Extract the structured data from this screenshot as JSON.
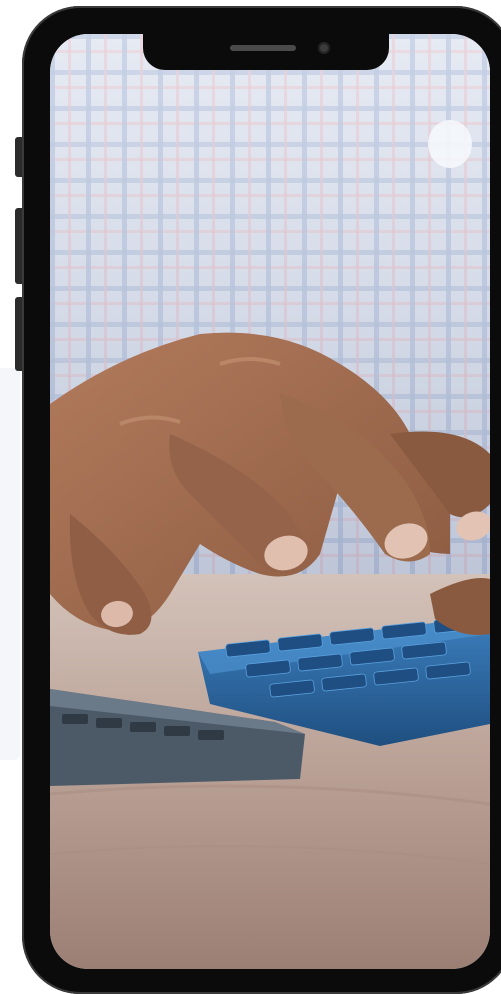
{
  "scene": {
    "description_icon": "phone-frame-icon",
    "photo_subject": "calculator-photo",
    "colors": {
      "frame": "#0b0b0b",
      "shirt": "#c7d0e4",
      "calculator": "#2f6fa8",
      "desk": "#b49a8f",
      "skin": "#a06c4f"
    }
  }
}
